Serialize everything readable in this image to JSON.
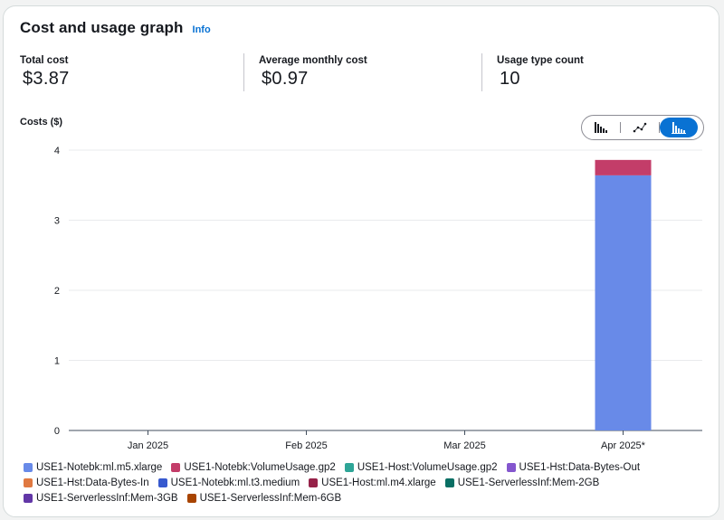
{
  "header": {
    "title": "Cost and usage graph",
    "info_label": "Info"
  },
  "metrics": [
    {
      "label": "Total cost",
      "value": "$3.87"
    },
    {
      "label": "Average monthly cost",
      "value": "$0.97"
    },
    {
      "label": "Usage type count",
      "value": "10"
    }
  ],
  "chart_toggle": {
    "options": [
      "bar-chart-icon",
      "line-chart-icon",
      "stacked-bar-chart-icon"
    ],
    "selected": "stacked-bar-chart-icon",
    "accent": "#0972d3"
  },
  "chart_data": {
    "type": "bar",
    "stacked": true,
    "ylabel": "Costs ($)",
    "xlabel": "",
    "ylim": [
      0,
      4
    ],
    "yticks": [
      0,
      1,
      2,
      3,
      4
    ],
    "grid": true,
    "legend_position": "bottom",
    "categories": [
      "Jan 2025",
      "Feb 2025",
      "Mar 2025",
      "Apr 2025*"
    ],
    "series": [
      {
        "name": "USE1-Notebk:ml.m5.xlarge",
        "color": "#688ae8",
        "values": [
          0,
          0,
          0,
          3.64
        ]
      },
      {
        "name": "USE1-Notebk:VolumeUsage.gp2",
        "color": "#c33d69",
        "values": [
          0,
          0,
          0,
          0.22
        ]
      },
      {
        "name": "USE1-Host:VolumeUsage.gp2",
        "color": "#2ea597",
        "values": [
          0,
          0,
          0,
          0
        ]
      },
      {
        "name": "USE1-Hst:Data-Bytes-Out",
        "color": "#8456ce",
        "values": [
          0,
          0,
          0,
          0
        ]
      },
      {
        "name": "USE1-Hst:Data-Bytes-In",
        "color": "#e07941",
        "values": [
          0,
          0,
          0,
          0
        ]
      },
      {
        "name": "USE1-Notebk:ml.t3.medium",
        "color": "#3759ce",
        "values": [
          0,
          0,
          0,
          0
        ]
      },
      {
        "name": "USE1-Host:ml.m4.xlarge",
        "color": "#962249",
        "values": [
          0,
          0,
          0,
          0
        ]
      },
      {
        "name": "USE1-ServerlessInf:Mem-2GB",
        "color": "#096f64",
        "values": [
          0,
          0,
          0,
          0
        ]
      },
      {
        "name": "USE1-ServerlessInf:Mem-3GB",
        "color": "#6237a7",
        "values": [
          0,
          0,
          0,
          0
        ]
      },
      {
        "name": "USE1-ServerlessInf:Mem-6GB",
        "color": "#a84401",
        "values": [
          0,
          0,
          0,
          0
        ]
      }
    ]
  }
}
